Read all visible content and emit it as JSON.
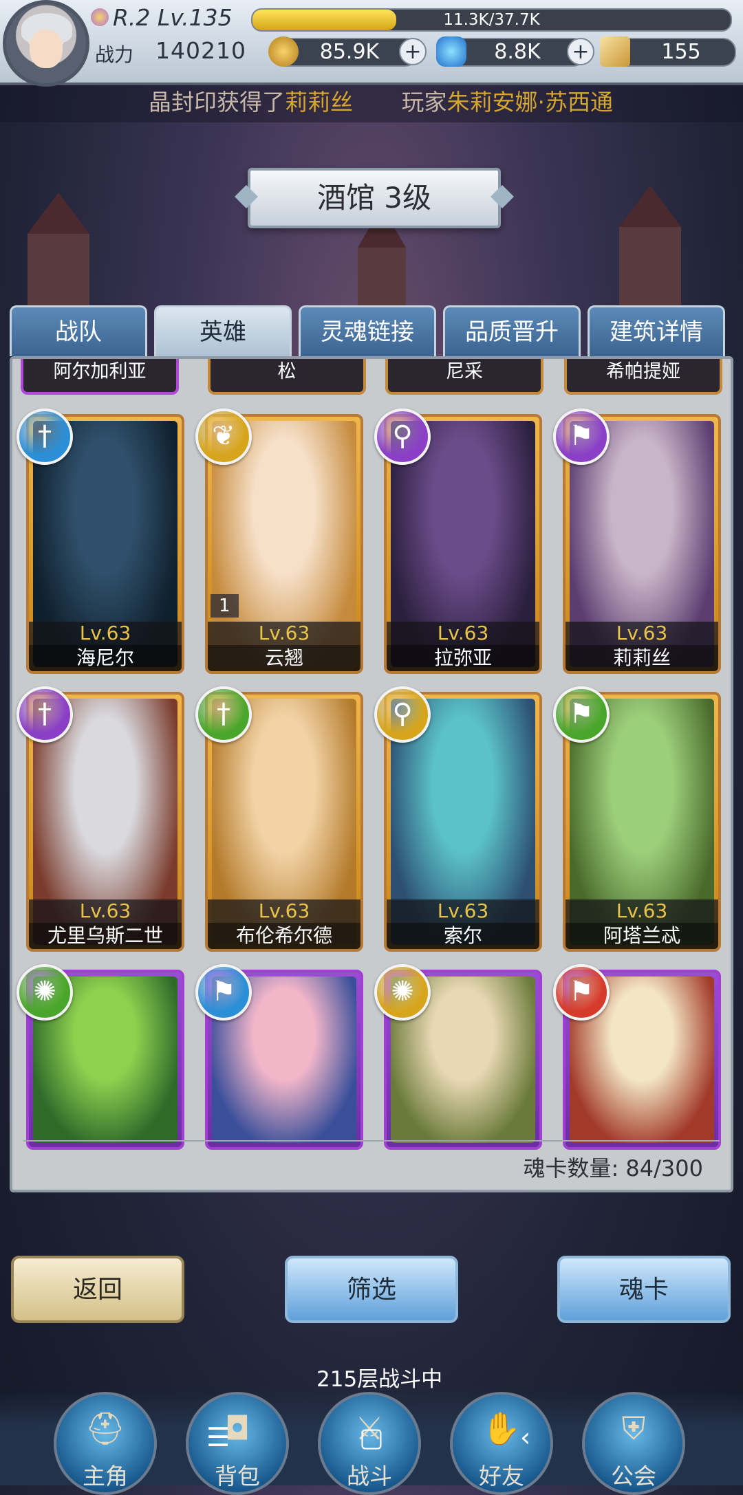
{
  "player": {
    "rank_level": "R.2 Lv.135",
    "exp_text": "11.3K/37.7K",
    "exp_ratio": 0.3,
    "power_label": "战力",
    "power_value": "140210"
  },
  "currencies": {
    "gold": "85.9K",
    "gems": "8.8K",
    "scrolls": "155"
  },
  "ticker": {
    "part1": "晶封印获得了",
    "hero": "莉莉丝",
    "part2": "玩家",
    "player": "朱莉安娜·苏西通"
  },
  "title": "酒馆 3级",
  "tabs": [
    "战队",
    "英雄",
    "灵魂链接",
    "品质晋升",
    "建筑详情"
  ],
  "active_tab": 1,
  "partial_row": [
    "阿尔加利亚",
    "松",
    "尼采",
    "希帕提娅"
  ],
  "heroes": [
    {
      "name": "海尼尔",
      "level": "Lv.63",
      "class_icon": "sword-icon",
      "badge_color": "#2a8fd6",
      "rarity": "gold"
    },
    {
      "name": "云翘",
      "level": "Lv.63",
      "class_icon": "wings-icon",
      "badge_color": "#d6a51c",
      "rarity": "gold",
      "stars": "1"
    },
    {
      "name": "拉弥亚",
      "level": "Lv.63",
      "class_icon": "staff-icon",
      "badge_color": "#8a3fc6",
      "rarity": "gold"
    },
    {
      "name": "莉莉丝",
      "level": "Lv.63",
      "class_icon": "bow-icon",
      "badge_color": "#8a3fc6",
      "rarity": "gold"
    },
    {
      "name": "尤里乌斯二世",
      "level": "Lv.63",
      "class_icon": "sword-icon",
      "badge_color": "#8a3fc6",
      "rarity": "gold"
    },
    {
      "name": "布伦希尔德",
      "level": "Lv.63",
      "class_icon": "sword-icon",
      "badge_color": "#4aa62a",
      "rarity": "gold"
    },
    {
      "name": "索尔",
      "level": "Lv.63",
      "class_icon": "staff-icon",
      "badge_color": "#d6a51c",
      "rarity": "gold"
    },
    {
      "name": "阿塔兰忒",
      "level": "Lv.63",
      "class_icon": "bow-icon",
      "badge_color": "#4aa62a",
      "rarity": "gold"
    },
    {
      "name": "",
      "level": "",
      "class_icon": "shuriken-icon",
      "badge_color": "#4aa62a",
      "rarity": "purple"
    },
    {
      "name": "",
      "level": "",
      "class_icon": "bow-icon",
      "badge_color": "#2a8fd6",
      "rarity": "purple"
    },
    {
      "name": "",
      "level": "",
      "class_icon": "shuriken-icon",
      "badge_color": "#d6a51c",
      "rarity": "purple"
    },
    {
      "name": "",
      "level": "",
      "class_icon": "bow-icon",
      "badge_color": "#d63a2a",
      "rarity": "purple"
    }
  ],
  "soul_count": "魂卡数量: 84/300",
  "buttons": {
    "back": "返回",
    "filter": "筛选",
    "soul_card": "魂卡"
  },
  "floor_status": "215层战斗中",
  "nav": [
    "主角",
    "背包",
    "战斗",
    "好友",
    "公会"
  ]
}
